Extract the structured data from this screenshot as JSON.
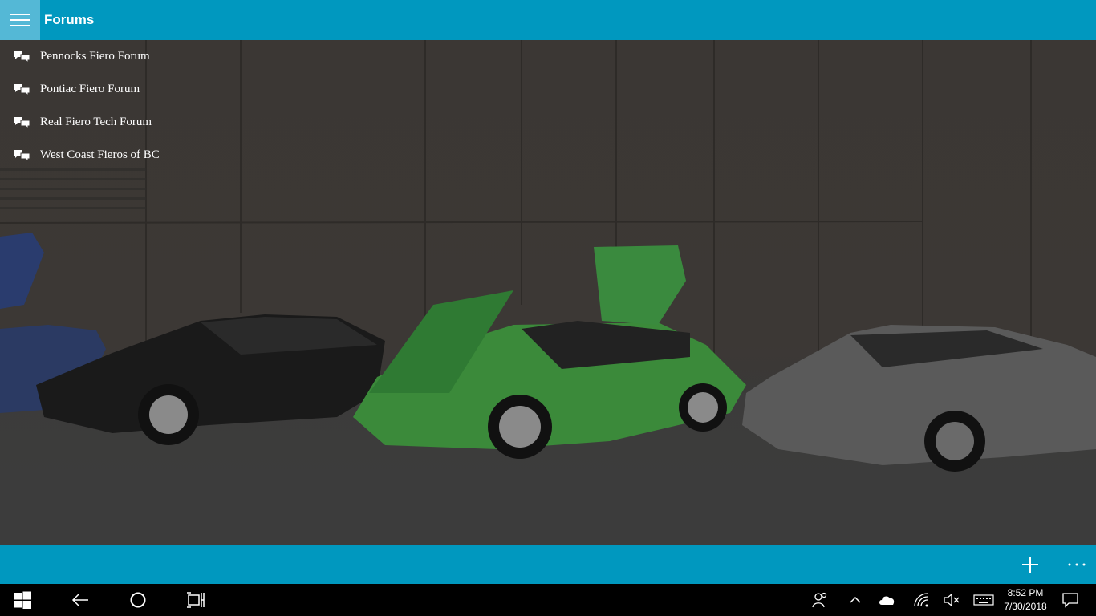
{
  "header": {
    "title": "Forums",
    "menu_icon": "hamburger-icon"
  },
  "forums": [
    {
      "label": "Pennocks Fiero Forum",
      "icon": "forum-chat-icon"
    },
    {
      "label": "Pontiac Fiero Forum",
      "icon": "forum-chat-icon"
    },
    {
      "label": "Real Fiero Tech Forum",
      "icon": "forum-chat-icon"
    },
    {
      "label": "West Coast Fieros of BC",
      "icon": "forum-chat-icon"
    }
  ],
  "appbar": {
    "add_icon": "plus-icon",
    "more_icon": "ellipsis-icon"
  },
  "taskbar": {
    "time": "8:52 PM",
    "date": "7/30/2018"
  },
  "colors": {
    "accent": "#0098bf",
    "accent_light": "#54b8d6",
    "taskbar": "#000000"
  }
}
